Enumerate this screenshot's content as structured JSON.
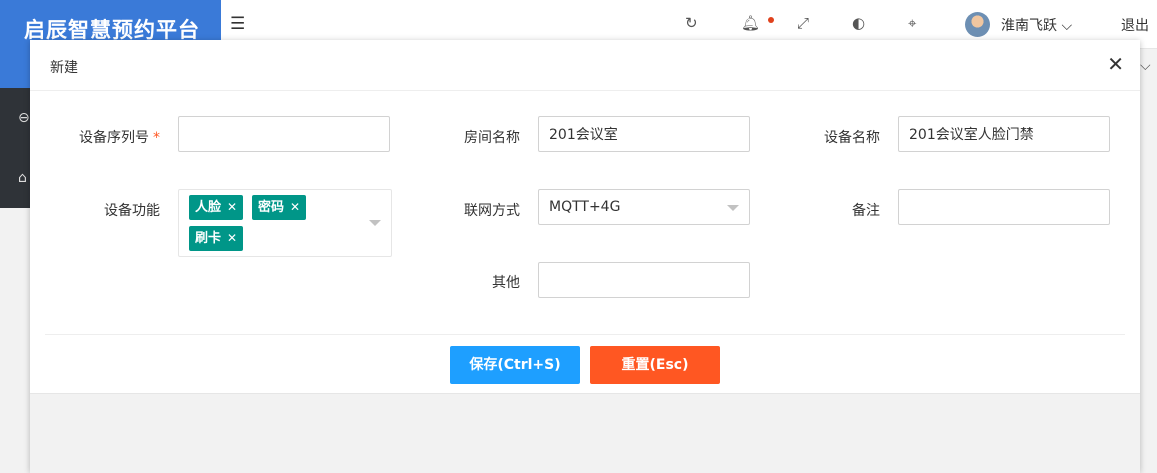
{
  "brand": {
    "title": "启辰智慧预约平台"
  },
  "header": {
    "user_name": "淮南飞跃",
    "logout_label": "退出"
  },
  "modal": {
    "title": "新建",
    "fields": {
      "serial": {
        "label": "设备序列号",
        "required_mark": "*",
        "value": ""
      },
      "room": {
        "label": "房间名称",
        "value": "201会议室"
      },
      "device_name": {
        "label": "设备名称",
        "value": "201会议室人脸门禁"
      },
      "functions": {
        "label": "设备功能",
        "tags": [
          "人脸",
          "密码",
          "刷卡"
        ]
      },
      "network": {
        "label": "联网方式",
        "value": "MQTT+4G"
      },
      "remark": {
        "label": "备注",
        "value": ""
      },
      "other": {
        "label": "其他",
        "value": ""
      }
    },
    "buttons": {
      "save": "保存(Ctrl+S)",
      "reset": "重置(Esc)"
    }
  },
  "colors": {
    "brand_bg": "#3a7ad8",
    "tag_bg": "#009688",
    "save_bg": "#1e9fff",
    "reset_bg": "#ff5722"
  },
  "icons": [
    "menu-toggle-icon",
    "refresh-icon",
    "bell-icon",
    "fullscreen-icon",
    "theme-icon",
    "tag-icon",
    "chevron-down-icon",
    "close-icon"
  ]
}
